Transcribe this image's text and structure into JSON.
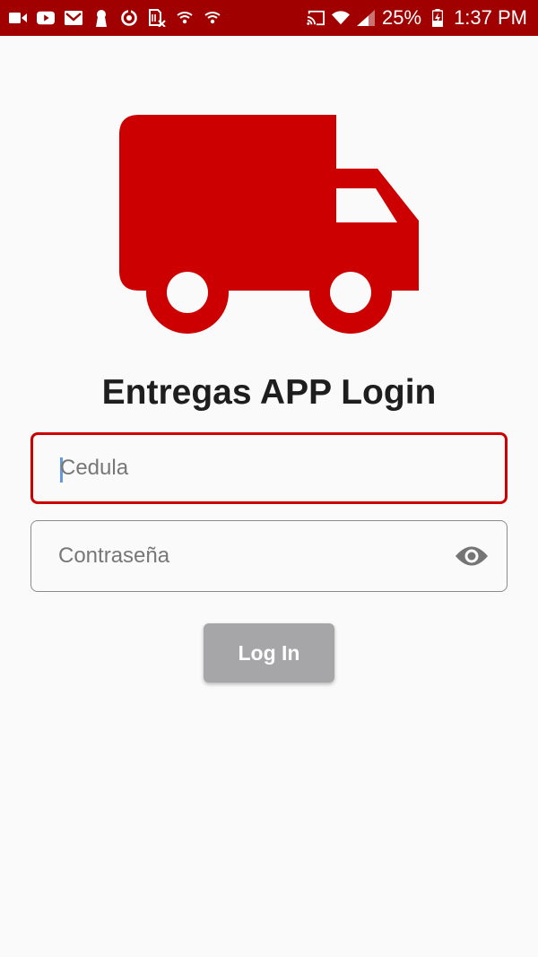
{
  "status_bar": {
    "battery_percent": "25%",
    "time": "1:37 PM",
    "left_icons": [
      "video-camera-icon",
      "youtube-icon",
      "gmail-icon",
      "keyhole-icon",
      "sync-icon",
      "no-sim-icon",
      "vpn-shield-icon",
      "vpn-shield-icon"
    ],
    "right_icons": [
      "cast-icon",
      "wifi-icon",
      "signal-icon",
      "battery-charging-icon"
    ]
  },
  "brand": {
    "accent_color": "#cc0000",
    "logo_icon": "delivery-truck-icon"
  },
  "title": "Entregas APP Login",
  "form": {
    "cedula_placeholder": "Cedula",
    "password_placeholder": "Contraseña",
    "password_toggle_icon": "eye-icon",
    "login_label": "Log In"
  }
}
